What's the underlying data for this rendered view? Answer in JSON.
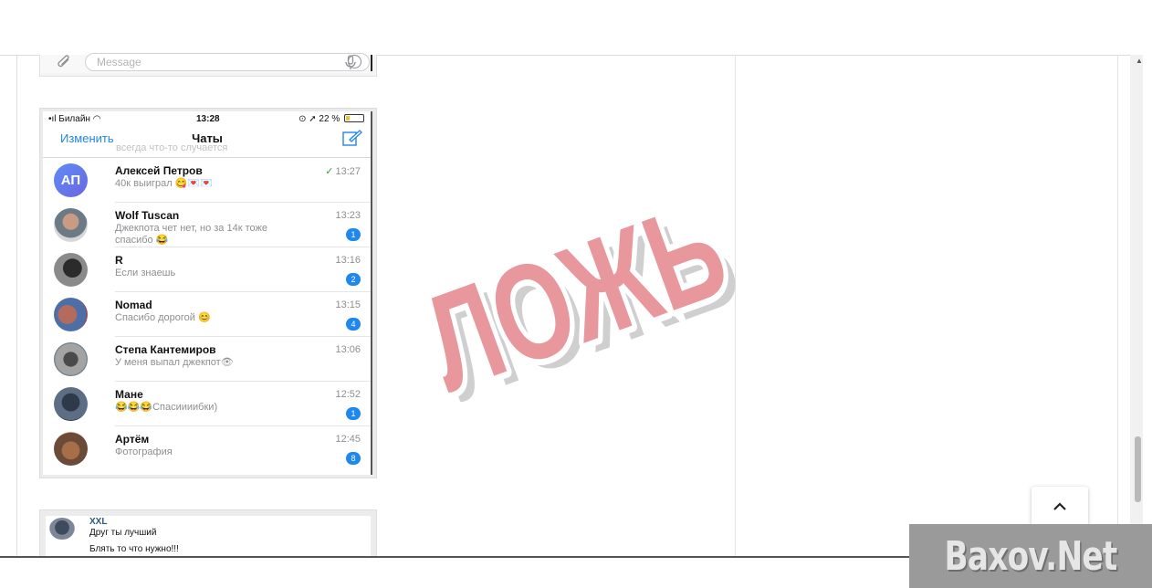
{
  "message_bar": {
    "placeholder": "Message"
  },
  "phone": {
    "status": {
      "carrier": "Билайн",
      "time": "13:28",
      "battery": "22 %",
      "battery_level": 0.22
    },
    "nav": {
      "edit_label": "Изменить",
      "title": "Чаты",
      "ghost_text": "всегда что-то случается"
    },
    "chats": [
      {
        "name": "Алексей Петров",
        "preview": "40к выиграл 😋💌💌",
        "time": "13:27",
        "read": true,
        "badge": "",
        "avatar_initials": "АП"
      },
      {
        "name": "Wolf Tuscan",
        "preview": "Джекпота чет нет, но за 14к тоже спасибо 😂",
        "time": "13:23",
        "badge": "1"
      },
      {
        "name": "R",
        "preview": "Если знаешь",
        "time": "13:16",
        "badge": "2"
      },
      {
        "name": "Nomad",
        "preview": "Спасибо дорогой 😊",
        "time": "13:15",
        "badge": "4"
      },
      {
        "name": "Степа  Кантемиров",
        "preview": "У меня выпал джекпот👁",
        "time": "13:06",
        "badge": ""
      },
      {
        "name": "Мане",
        "preview": "😂😂😂Спасиииибки)",
        "time": "12:52",
        "badge": "1"
      },
      {
        "name": "Артём",
        "preview": "Фотография",
        "time": "12:45",
        "badge": "8"
      }
    ]
  },
  "comment": {
    "author": "XXL",
    "line1": "Друг ты лучший",
    "line2": "Блять то что нужно!!!"
  },
  "stamp": {
    "text": "ЛОЖЬ",
    "color": "#e8989c"
  },
  "watermark": {
    "text": "Baxov.Net"
  }
}
